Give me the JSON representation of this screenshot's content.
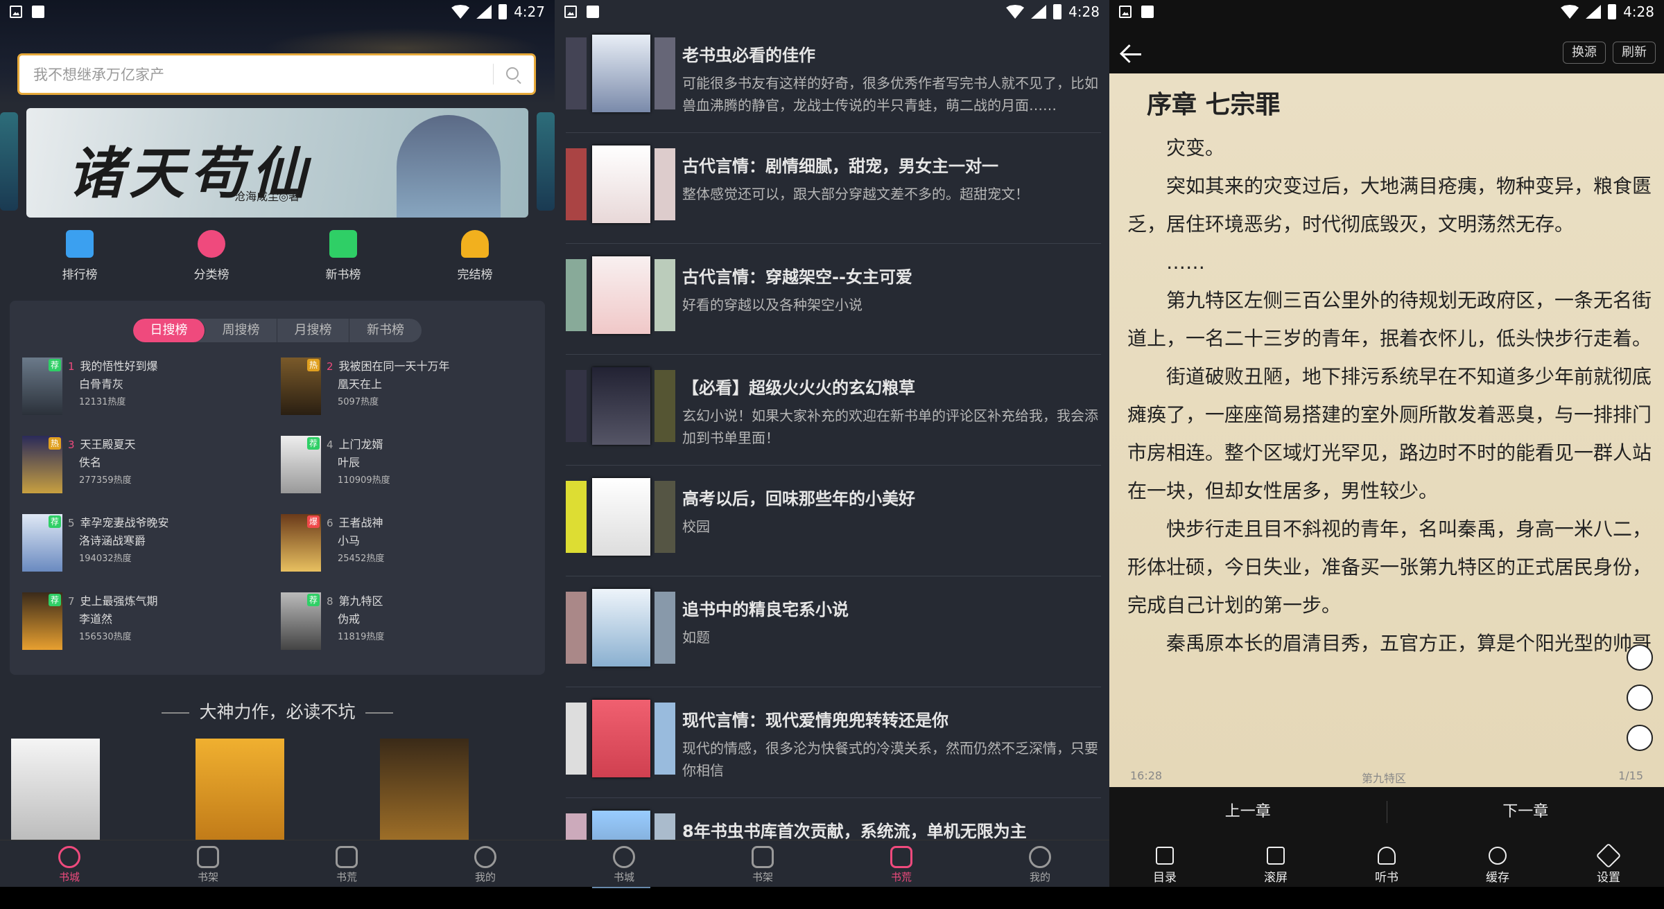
{
  "status": {
    "s1_time": "4:27",
    "s2_time": "4:28",
    "s3_time": "4:28"
  },
  "home": {
    "search_placeholder": "我不想继承万亿家产",
    "banner_title": "诸天苟仙",
    "banner_sub": "沧海成尘◎著",
    "quick": [
      {
        "label": "排行榜",
        "icon": "thumbs-up-icon",
        "color": "#3ba0f0"
      },
      {
        "label": "分类榜",
        "icon": "flame-icon",
        "color": "#ef4a7d"
      },
      {
        "label": "新书榜",
        "icon": "book-icon",
        "color": "#2fcf66"
      },
      {
        "label": "完结榜",
        "icon": "trophy-icon",
        "color": "#f2b01e"
      }
    ],
    "tabs": [
      "日搜榜",
      "周搜榜",
      "月搜榜",
      "新书榜"
    ],
    "ranks": [
      {
        "num": "1",
        "title": "我的悟性好到爆",
        "author": "白骨青灰",
        "heat": "12131热度",
        "tag": "荐"
      },
      {
        "num": "2",
        "title": "我被困在同一天十万年",
        "author": "凰天在上",
        "heat": "5097热度",
        "tag": "热"
      },
      {
        "num": "3",
        "title": "天王殿夏天",
        "author": "佚名",
        "heat": "277359热度",
        "tag": "热"
      },
      {
        "num": "4",
        "title": "上门龙婿",
        "author": "叶辰",
        "heat": "110909热度",
        "tag": "荐"
      },
      {
        "num": "5",
        "title": "幸孕宠妻战爷晚安",
        "author": "洛诗涵战寒爵",
        "heat": "194032热度",
        "tag": "荐"
      },
      {
        "num": "6",
        "title": "王者战神",
        "author": "小马",
        "heat": "25452热度",
        "tag": "爆"
      },
      {
        "num": "7",
        "title": "史上最强炼气期",
        "author": "李道然",
        "heat": "156530热度",
        "tag": "荐"
      },
      {
        "num": "8",
        "title": "第九特区",
        "author": "伪戒",
        "heat": "11819热度",
        "tag": "荐"
      }
    ],
    "section_title": "大神力作，必读不坑"
  },
  "booklists": [
    {
      "title": "老书虫必看的佳作",
      "desc": "可能很多书友有这样的好奇，很多优秀作者写完书人就不见了，比如兽血沸腾的静官，龙战士传说的半只青蛙，萌二战的月面……"
    },
    {
      "title": "古代言情：剧情细腻，甜宠，男女主一对一",
      "desc": "整体感觉还可以，跟大部分穿越文差不多的。超甜宠文！"
    },
    {
      "title": "古代言情：穿越架空--女主可爱",
      "desc": "好看的穿越以及各种架空小说"
    },
    {
      "title": "【必看】超级火火火的玄幻粮草",
      "desc": "玄幻小说！如果大家补充的欢迎在新书单的评论区补充给我，我会添加到书单里面！"
    },
    {
      "title": "高考以后，回味那些年的小美好",
      "desc": "校园"
    },
    {
      "title": "追书中的精良宅系小说",
      "desc": "如题"
    },
    {
      "title": "现代言情：现代爱情兜兜转转还是你",
      "desc": "现代的情感，很多沦为快餐式的冷漠关系，然而仍然不乏深情，只要你相信"
    },
    {
      "title": "8年书虫书库首次贡献，系统流，单机无限为主",
      "desc": ""
    }
  ],
  "nav": {
    "tabs": [
      "书城",
      "书架",
      "书荒",
      "我的"
    ]
  },
  "reader": {
    "btn_source": "换源",
    "btn_refresh": "刷新",
    "chapter": "序章 七宗罪",
    "paragraphs": [
      "灾变。",
      "突如其来的灾变过后，大地满目疮痍，物种变异，粮食匮乏，居住环境恶劣，时代彻底毁灭，文明荡然无存。",
      "……",
      "第九特区左侧三百公里外的待规划无政府区，一条无名街道上，一名二十三岁的青年，抿着衣怀儿，低头快步行走着。",
      "街道破败丑陋，地下排污系统早在不知道多少年前就彻底瘫痪了，一座座简易搭建的室外厕所散发着恶臭，与一排排门市房相连。整个区域灯光罕见，路边时不时的能看见一群人站在一块，但却女性居多，男性较少。",
      "快步行走且目不斜视的青年，名叫秦禹，身高一米八二，形体壮硕，今日失业，准备买一张第九特区的正式居民身份，完成自己计划的第一步。",
      "秦禹原本长的眉清目秀，五官方正，算是个阳光型的帅哥，可现如今打扮的却有些邋遢，胡子没刮，略长的头发黏"
    ],
    "time": "16:28",
    "book": "第九特区",
    "page": "1/15",
    "prev": "上一章",
    "next": "下一章",
    "tools": [
      "目录",
      "滚屏",
      "听书",
      "缓存",
      "设置"
    ]
  }
}
